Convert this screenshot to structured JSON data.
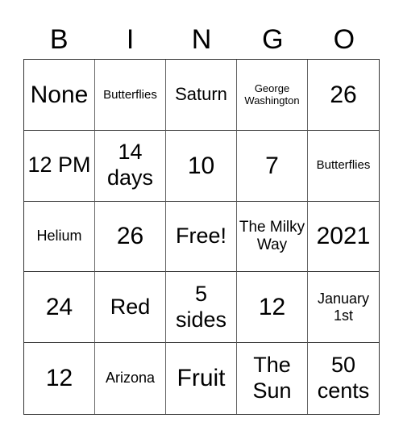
{
  "header": {
    "letters": [
      "B",
      "I",
      "N",
      "G",
      "O"
    ]
  },
  "card": {
    "rows": [
      [
        "None",
        "Butterflies",
        "Saturn",
        "George Washington",
        "26"
      ],
      [
        "12 PM",
        "14 days",
        "10",
        "7",
        "Butterflies"
      ],
      [
        "Helium",
        "26",
        "Free!",
        "The Milky Way",
        "2021"
      ],
      [
        "24",
        "Red",
        "5 sides",
        "12",
        "January 1st"
      ],
      [
        "12",
        "Arizona",
        "Fruit",
        "The Sun",
        "50 cents"
      ]
    ],
    "free_space": "Free!"
  },
  "colors": {
    "background": "#ffffff",
    "text": "#000000",
    "grid_line": "#333333"
  }
}
